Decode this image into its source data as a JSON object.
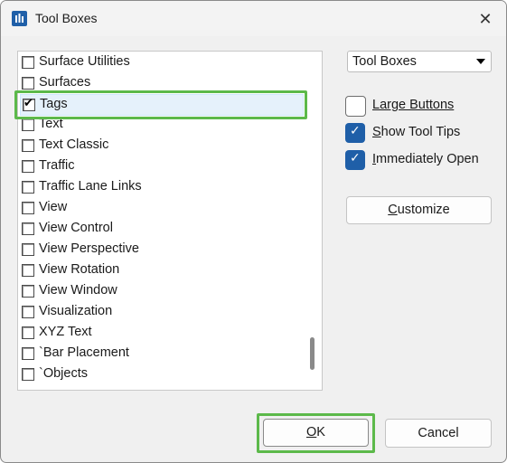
{
  "window": {
    "title": "Tool Boxes",
    "close_label": "✕"
  },
  "list": {
    "items": [
      {
        "label": "Surface Utilities",
        "checked": false
      },
      {
        "label": "Surfaces",
        "checked": false
      },
      {
        "label": "Tags",
        "checked": true,
        "selected": true
      },
      {
        "label": "Text",
        "checked": false
      },
      {
        "label": "Text Classic",
        "checked": false
      },
      {
        "label": "Traffic",
        "checked": false
      },
      {
        "label": "Traffic Lane Links",
        "checked": false
      },
      {
        "label": "View",
        "checked": false
      },
      {
        "label": "View Control",
        "checked": false
      },
      {
        "label": "View Perspective",
        "checked": false
      },
      {
        "label": "View Rotation",
        "checked": false
      },
      {
        "label": "View Window",
        "checked": false
      },
      {
        "label": "Visualization",
        "checked": false
      },
      {
        "label": "XYZ Text",
        "checked": false
      },
      {
        "label": "`Bar Placement",
        "checked": false
      },
      {
        "label": "`Objects",
        "checked": false
      }
    ]
  },
  "dropdown": {
    "value": "Tool Boxes"
  },
  "options": {
    "large_buttons": {
      "label": "Large Buttons",
      "checked": false
    },
    "show_tool_tips": {
      "label": "Show Tool Tips",
      "checked": true
    },
    "immediately_open": {
      "label": "Immediately Open",
      "checked": true
    }
  },
  "buttons": {
    "customize": "Customize",
    "ok": "OK",
    "cancel": "Cancel"
  },
  "colors": {
    "accent": "#1f5fa8",
    "highlight": "#5cb94a",
    "selection": "#e5f1fb"
  },
  "icons": {
    "app": "toolbox-app-icon",
    "close": "close-icon",
    "dropdown": "chevron-down-icon"
  }
}
